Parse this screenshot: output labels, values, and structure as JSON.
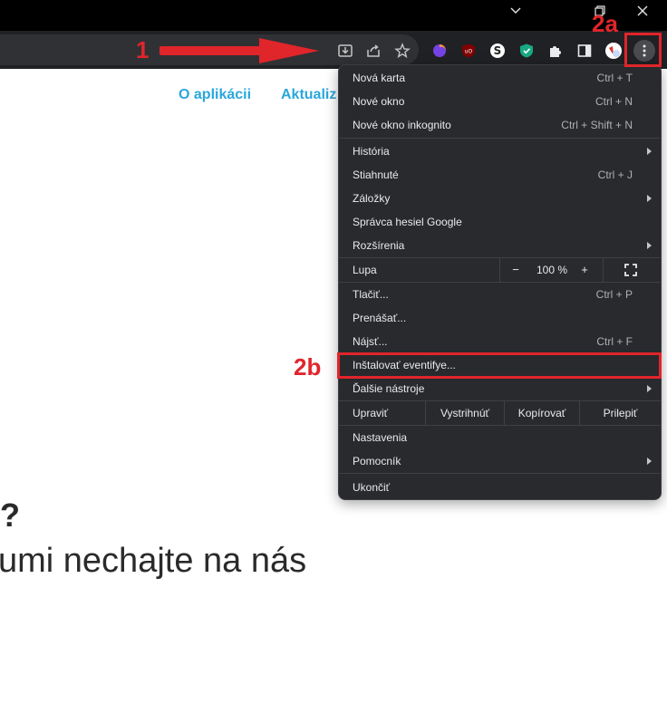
{
  "window_controls": {
    "minimize": "⌄",
    "restore": "❐",
    "close": "✕"
  },
  "toolbar": {
    "icons": [
      "install-app-icon",
      "share-icon",
      "bookmark-star-icon",
      "extension-firefox-icon",
      "extension-ublock-icon",
      "extension-s-icon",
      "extension-shield-icon",
      "extensions-puzzle-icon",
      "side-panel-icon",
      "profile-avatar-icon",
      "kebab-menu-icon"
    ]
  },
  "page": {
    "nav_about": "O aplikácii",
    "nav_updates": "Aktualiz",
    "text_question": "?",
    "text_line": "umi nechajte na nás"
  },
  "menu": {
    "new_tab": {
      "label": "Nová karta",
      "shortcut": "Ctrl + T"
    },
    "new_window": {
      "label": "Nové okno",
      "shortcut": "Ctrl + N"
    },
    "incognito": {
      "label": "Nové okno inkognito",
      "shortcut": "Ctrl + Shift + N"
    },
    "history": {
      "label": "História"
    },
    "downloads": {
      "label": "Stiahnuté",
      "shortcut": "Ctrl + J"
    },
    "bookmarks": {
      "label": "Záložky"
    },
    "passwords": {
      "label": "Správca hesiel Google"
    },
    "extensions": {
      "label": "Rozšírenia"
    },
    "zoom": {
      "label": "Lupa",
      "minus": "−",
      "value": "100 %",
      "plus": "+"
    },
    "print": {
      "label": "Tlačiť...",
      "shortcut": "Ctrl + P"
    },
    "cast": {
      "label": "Prenášať..."
    },
    "find": {
      "label": "Nájsť...",
      "shortcut": "Ctrl + F"
    },
    "install": {
      "label": "Inštalovať eventifye..."
    },
    "more_tools": {
      "label": "Ďalšie nástroje"
    },
    "edit": {
      "label": "Upraviť",
      "cut": "Vystrihnúť",
      "copy": "Kopírovať",
      "paste": "Prilepiť"
    },
    "settings": {
      "label": "Nastavenia"
    },
    "help": {
      "label": "Pomocník"
    },
    "exit": {
      "label": "Ukončiť"
    }
  },
  "annotations": {
    "step1": "1",
    "step2a": "2a",
    "step2b": "2b"
  },
  "colors": {
    "annotation_red": "#e0252b",
    "menu_bg": "#292a2d",
    "link_blue": "#2aa7dc"
  }
}
